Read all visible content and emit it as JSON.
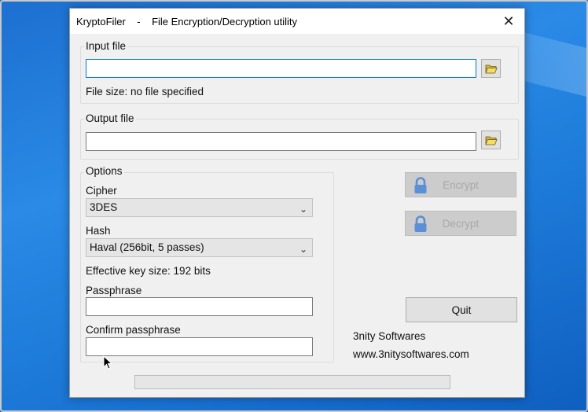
{
  "window": {
    "title": "KryptoFiler    -    File Encryption/Decryption utility",
    "close_glyph": "✕"
  },
  "input_group": {
    "label": "Input file",
    "value": "",
    "file_size_text": "File size: no file specified",
    "browse_icon": "folder-open-icon"
  },
  "output_group": {
    "label": "Output file",
    "value": "",
    "browse_icon": "folder-open-icon"
  },
  "options": {
    "label": "Options",
    "cipher_label": "Cipher",
    "cipher_value": "3DES",
    "hash_label": "Hash",
    "hash_value": "Haval (256bit, 5 passes)",
    "key_size_text": "Effective key size: 192 bits",
    "passphrase_label": "Passphrase",
    "passphrase_value": "",
    "confirm_label": "Confirm passphrase",
    "confirm_value": ""
  },
  "actions": {
    "encrypt_label": "Encrypt",
    "decrypt_label": "Decrypt",
    "quit_label": "Quit",
    "lock_icon": "lock-icon",
    "disabled_color": "#a8a8a8",
    "lock_color": "#5b8fd6"
  },
  "vendor": {
    "name": "3nity Softwares",
    "url": "www.3nitysoftwares.com"
  },
  "progress": {
    "value": 0
  }
}
